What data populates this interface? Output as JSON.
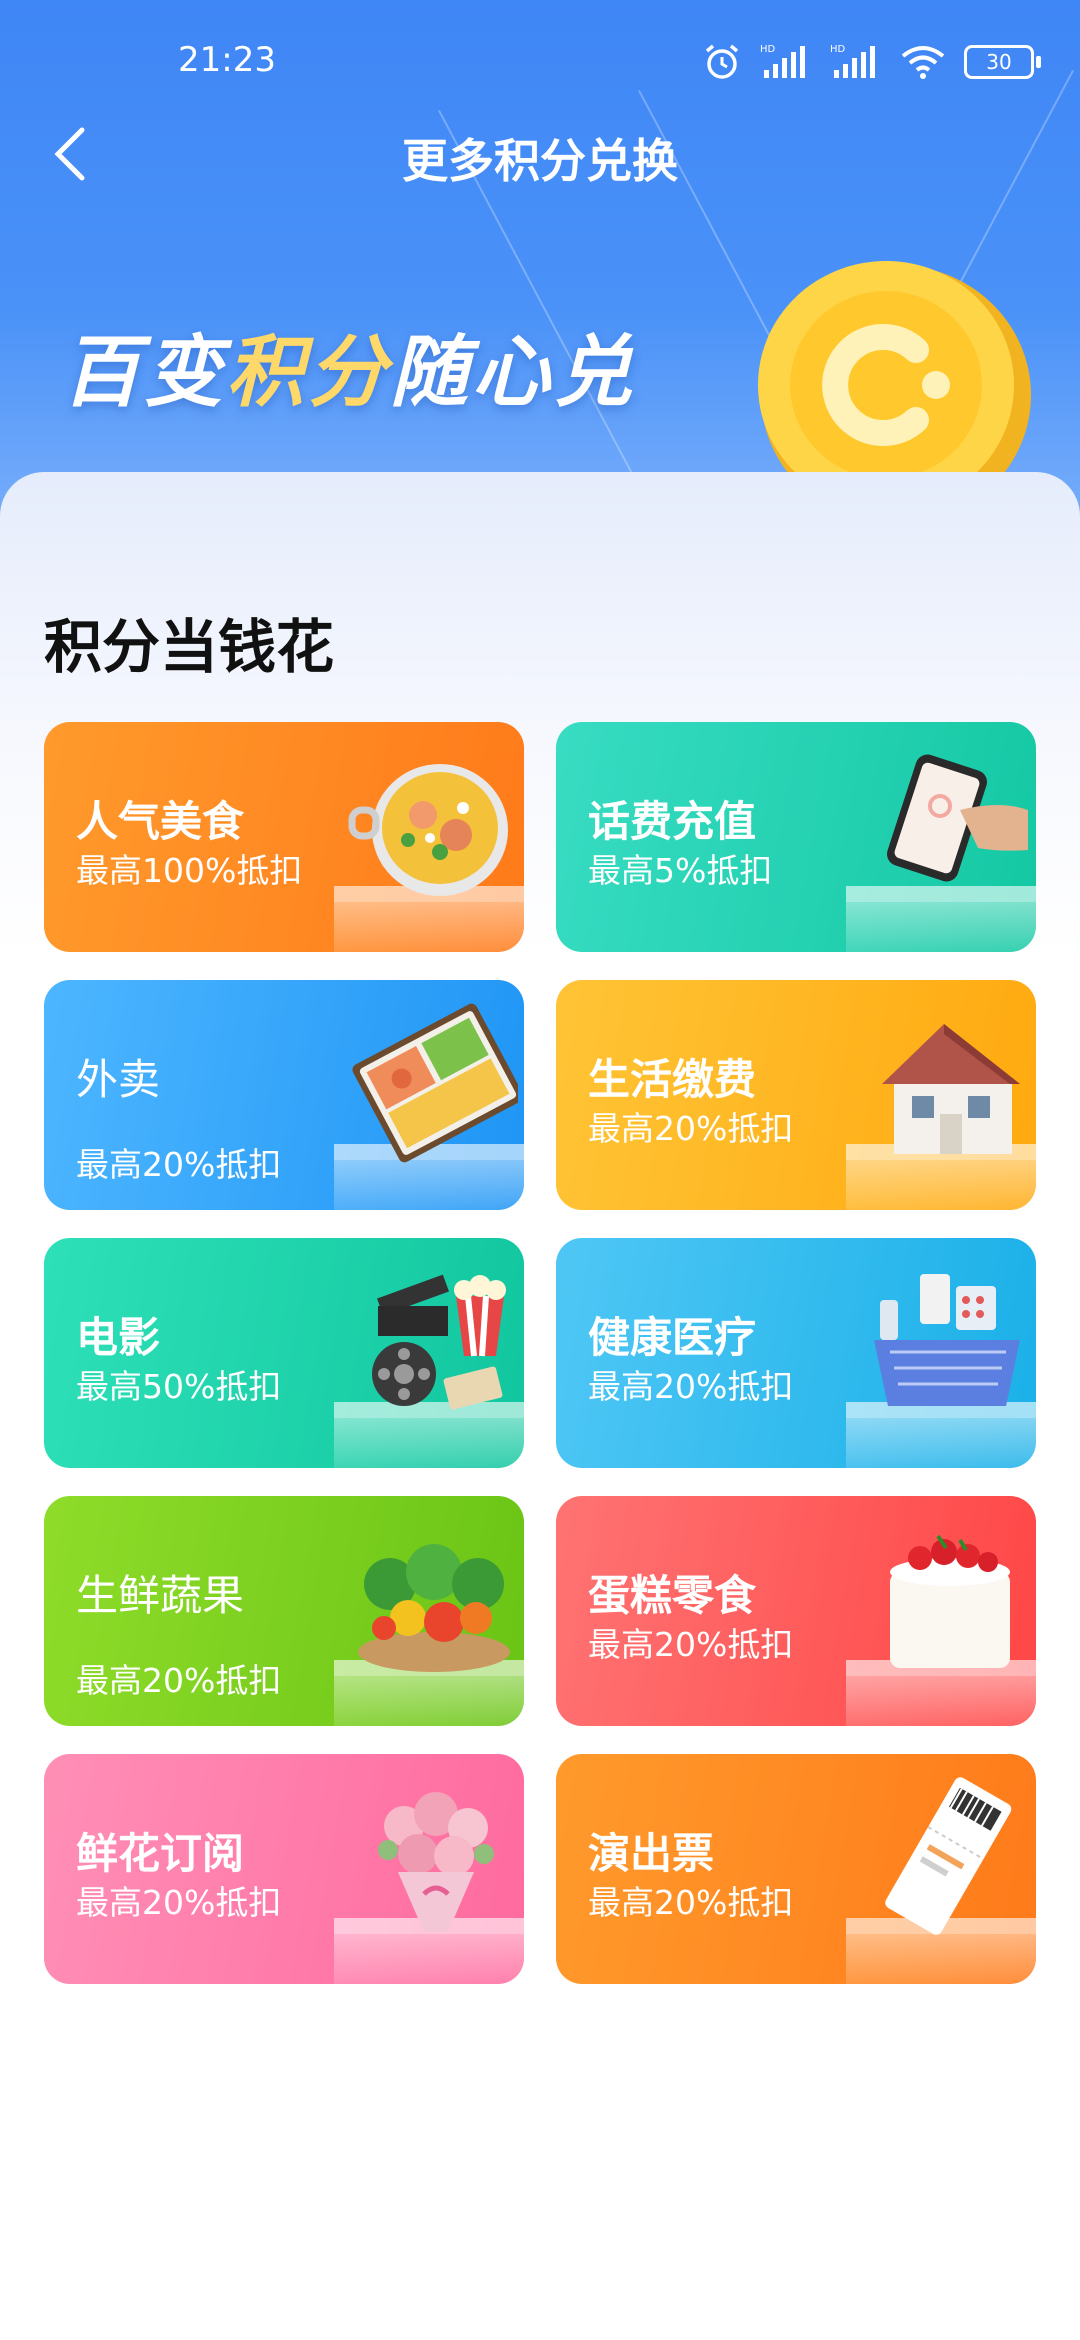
{
  "status_bar": {
    "time": "21:23",
    "battery": "30"
  },
  "header": {
    "title": "更多积分兑换"
  },
  "banner": {
    "part1": "百变",
    "part2": "积分",
    "part3": "随心兑"
  },
  "section": {
    "title": "积分当钱花"
  },
  "cards": [
    {
      "name": "人气美食",
      "desc": "最高100%抵扣",
      "icon": "food-pot-icon"
    },
    {
      "name": "话费充值",
      "desc": "最高5%抵扣",
      "icon": "phone-recharge-icon"
    },
    {
      "name": "外卖",
      "desc": "最高20%抵扣",
      "icon": "takeout-box-icon"
    },
    {
      "name": "生活缴费",
      "desc": "最高20%抵扣",
      "icon": "house-icon"
    },
    {
      "name": "电影",
      "desc": "最高50%抵扣",
      "icon": "movie-clapper-icon"
    },
    {
      "name": "健康医疗",
      "desc": "最高20%抵扣",
      "icon": "medicine-basket-icon"
    },
    {
      "name": "生鲜蔬果",
      "desc": "最高20%抵扣",
      "icon": "vegetables-icon"
    },
    {
      "name": "蛋糕零食",
      "desc": "最高20%抵扣",
      "icon": "cake-icon"
    },
    {
      "name": "鲜花订阅",
      "desc": "最高20%抵扣",
      "icon": "flower-bouquet-icon"
    },
    {
      "name": "演出票",
      "desc": "最高20%抵扣",
      "icon": "ticket-icon"
    }
  ],
  "colors": {
    "header_blue": "#3f86f6",
    "orange": "#ff8a25",
    "teal": "#1fcfae",
    "blue": "#2fa8f8",
    "amber": "#ffb31a",
    "green": "#7cd321",
    "red": "#ff5d5d",
    "pink": "#ff7aa8"
  }
}
